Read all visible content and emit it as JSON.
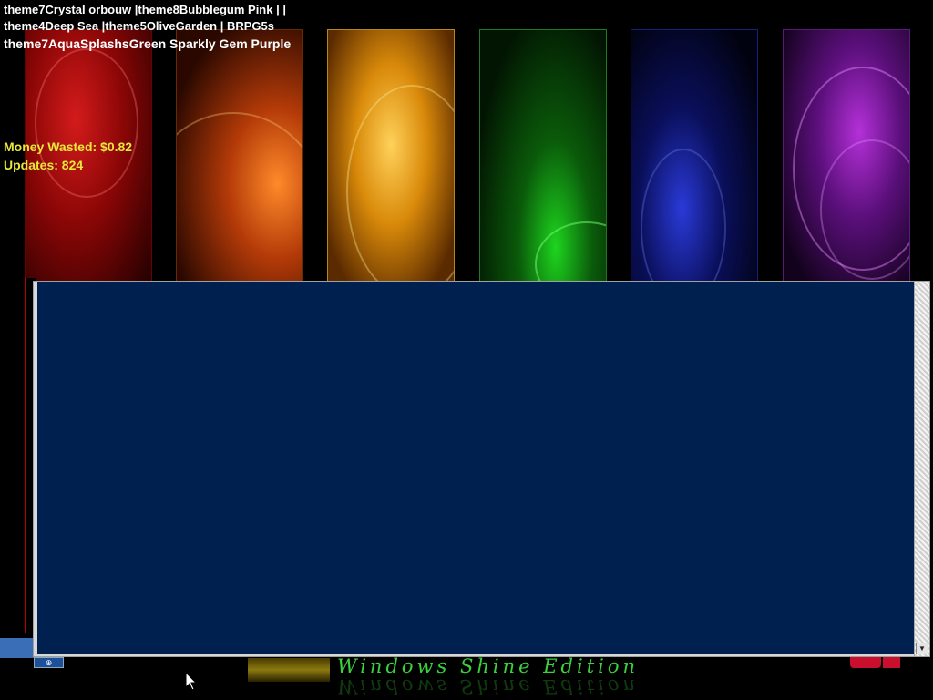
{
  "debug_lines": [
    "theme7Crystal orbouw |theme8Bubblegum Pink | |",
    "theme4Deep Sea |theme5OliveGarden | BRPG5s",
    "theme7AquaSplashsGreen Sparkly Gem Purple"
  ],
  "stats": {
    "money_label": "Money Wasted: $0.82",
    "updates_label": "Updates: 824"
  },
  "brand": {
    "name": "Windows Shine Edition"
  },
  "colors": {
    "window_content": "#00214f",
    "stats_text": "#e8e83a",
    "brand_text": "#3bd13b"
  }
}
